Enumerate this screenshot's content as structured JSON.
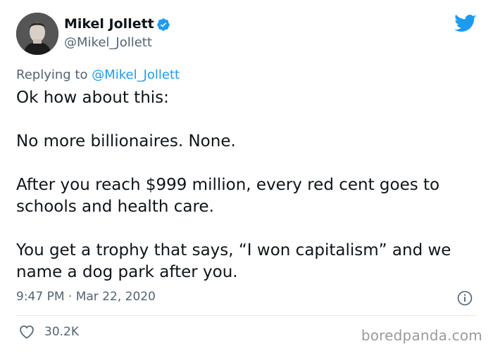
{
  "author": {
    "display_name": "Mikel Jollett",
    "handle": "@Mikel_Jollett",
    "verified": true
  },
  "reply_context": {
    "prefix": "Replying to ",
    "mention": "@Mikel_Jollett"
  },
  "tweet": {
    "paragraphs": [
      "Ok how about this:",
      "No more billionaires. None.",
      "After you reach $999 million, every red cent goes to schools and health care.",
      "You get a trophy that says, “I won capitalism” and we name a dog park after you."
    ],
    "timestamp": "9:47 PM · Mar 22, 2020"
  },
  "engagement": {
    "likes": "30.2K"
  },
  "watermark": "boredpanda.com",
  "colors": {
    "twitter_blue": "#1d9bf0",
    "secondary_text": "#536471"
  },
  "icons": {
    "brand": "twitter-bird-icon",
    "verified": "verified-badge-icon",
    "info": "info-icon",
    "like": "heart-icon"
  }
}
